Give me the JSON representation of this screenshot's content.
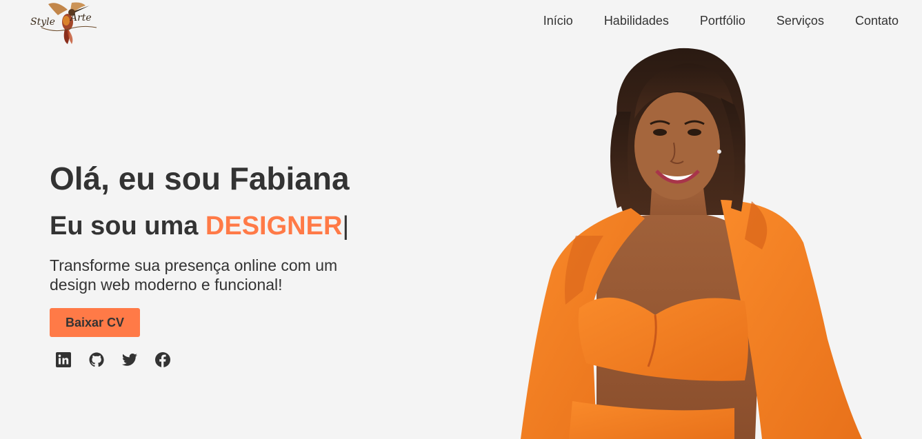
{
  "logo": {
    "word1": "Style",
    "word2": "Arte"
  },
  "nav": {
    "items": [
      {
        "label": "Início"
      },
      {
        "label": "Habilidades"
      },
      {
        "label": "Portfólio"
      },
      {
        "label": "Serviços"
      },
      {
        "label": "Contato"
      }
    ]
  },
  "hero": {
    "title": "Olá, eu sou Fabiana",
    "subtitle_prefix": "Eu sou uma ",
    "subtitle_highlight": "DESIGNER",
    "subtitle_cursor": "|",
    "description": "Transforme sua presença online com um design web moderno e funcional!",
    "cv_button": "Baixar CV"
  },
  "social": [
    {
      "icon": "linkedin-icon"
    },
    {
      "icon": "github-icon"
    },
    {
      "icon": "twitter-icon"
    },
    {
      "icon": "facebook-icon"
    }
  ],
  "colors": {
    "background": "#f4f4f4",
    "accent": "#ff7a47",
    "text": "#333333",
    "outfit": "#f7841e"
  }
}
